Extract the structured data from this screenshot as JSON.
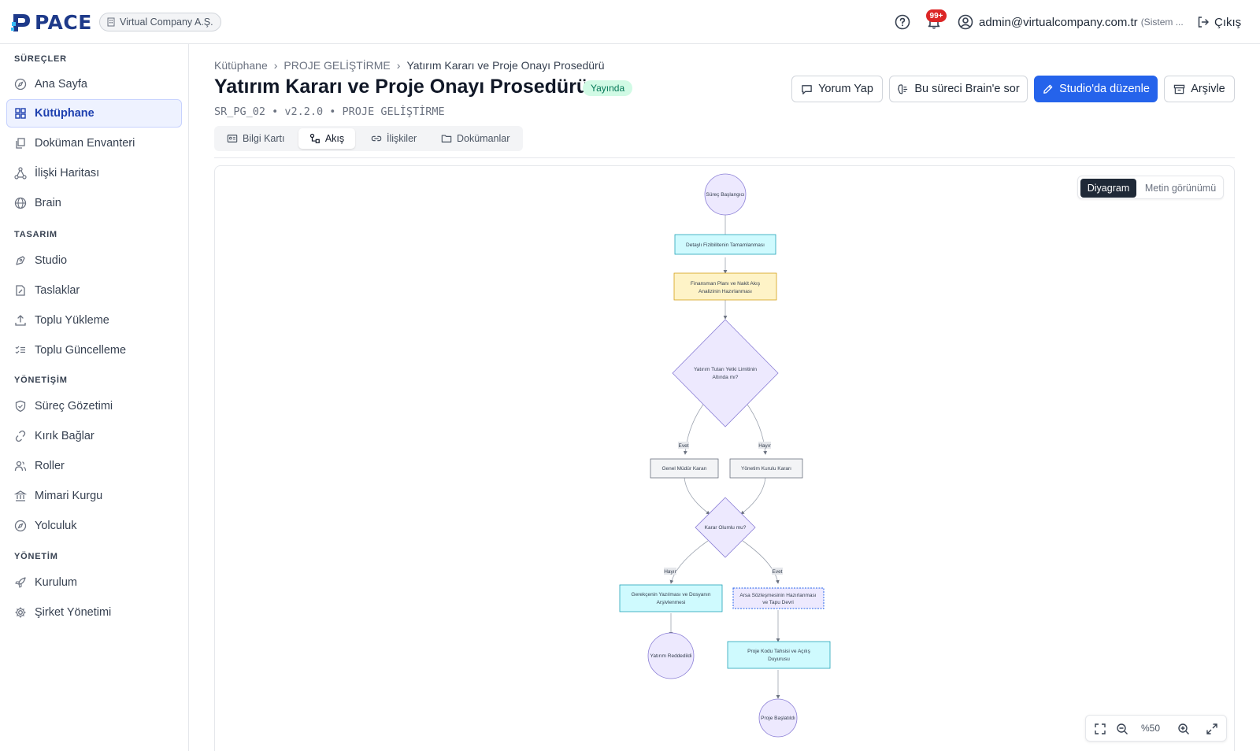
{
  "app": {
    "logo_text": "PACE",
    "company": "Virtual Company A.Ş."
  },
  "topbar": {
    "notification_count": "99+",
    "user_email": "admin@virtualcompany.com.tr",
    "user_role": "(Sistem ...",
    "logout_label": "Çıkış"
  },
  "sidebar": {
    "sections": [
      {
        "title": "SÜREÇLER",
        "items": [
          "Ana Sayfa",
          "Kütüphane",
          "Doküman Envanteri",
          "İlişki Haritası",
          "Brain"
        ]
      },
      {
        "title": "TASARIM",
        "items": [
          "Studio",
          "Taslaklar",
          "Toplu Yükleme",
          "Toplu Güncelleme"
        ]
      },
      {
        "title": "YÖNETİŞİM",
        "items": [
          "Süreç Gözetimi",
          "Kırık Bağlar",
          "Roller",
          "Mimari Kurgu",
          "Yolculuk"
        ]
      },
      {
        "title": "YÖNETİM",
        "items": [
          "Kurulum",
          "Şirket Yönetimi"
        ]
      }
    ],
    "active_item": "Kütüphane"
  },
  "breadcrumb": [
    "Kütüphane",
    "PROJE GELİŞTİRME",
    "Yatırım Kararı ve Proje Onayı Prosedürü"
  ],
  "page": {
    "title": "Yatırım Kararı ve Proje Onayı Prosedürü",
    "status": "Yayında",
    "meta": "SR_PG_02 • v2.2.0 • PROJE GELİŞTİRME"
  },
  "actions": {
    "comment": "Yorum Yap",
    "ask_brain": "Bu süreci Brain'e sor",
    "edit_studio": "Studio'da düzenle",
    "archive": "Arşivle"
  },
  "tabs": [
    "Bilgi Kartı",
    "Akış",
    "İlişkiler",
    "Dokümanlar"
  ],
  "active_tab": "Akış",
  "view_toggle": {
    "diagram": "Diyagram",
    "text": "Metin görünümü",
    "active": "Diyagram"
  },
  "zoom": {
    "level": "%50"
  },
  "colors": {
    "primary": "#2563eb",
    "active_nav_bg": "#eef2ff",
    "status_bg": "#d1fae5",
    "status_text": "#047857",
    "badge": "#dc2626",
    "node_start": "#ede9fe",
    "node_task": "#cffafe",
    "node_finance": "#fef3c7",
    "node_decision": "#ede9fe",
    "node_role": "#f3f4f6"
  },
  "flow": {
    "nodes": {
      "start": "Süreç Başlangıcı",
      "fizibilite": "Detaylı Fizibilitenin Tamamlanması",
      "finans": [
        "Finansman Planı ve Nakit Akış",
        "Analizinin Hazırlanması"
      ],
      "karar1": [
        "Yatırım Tutarı Yetki Limitinin",
        "Altında mı?"
      ],
      "gm": "Genel Müdür Kararı",
      "yk": "Yönetim Kurulu Kararı",
      "karar2": "Karar Olumlu mu?",
      "gerekce": [
        "Gerekçenin Yazılması ve Dosyanın",
        "Arşivlenmesi"
      ],
      "arsa": [
        "Arsa Sözleşmesinin Hazırlanması",
        "ve Tapu Devri"
      ],
      "red": "Yatırım Reddedildi",
      "kod": [
        "Proje Kodu Tahsisi ve Açılış",
        "Duyurusu"
      ],
      "end": "Proje Başlatıldı"
    },
    "edge_labels": {
      "yes": "Evet",
      "no": "Hayır"
    }
  }
}
